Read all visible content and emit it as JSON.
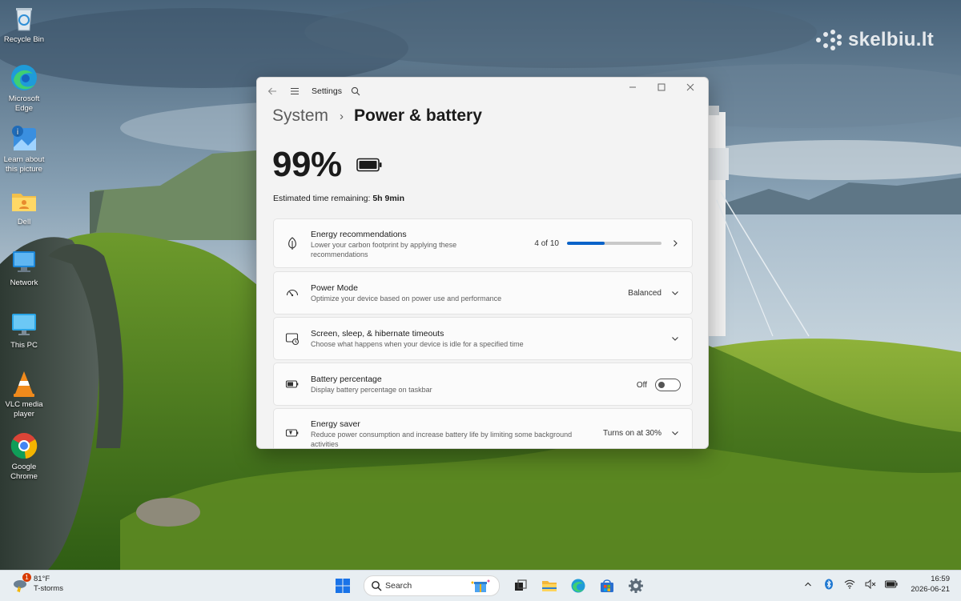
{
  "watermark": "skelbiu.lt",
  "desktop_icons": [
    {
      "label": "Recycle Bin",
      "icon": "recycle-bin-icon"
    },
    {
      "label": "Microsoft Edge",
      "icon": "edge-icon"
    },
    {
      "label": "Learn about this picture",
      "icon": "learn-picture-icon"
    },
    {
      "label": "Dell",
      "icon": "folder-icon"
    },
    {
      "label": "Network",
      "icon": "network-icon"
    },
    {
      "label": "This PC",
      "icon": "monitor-icon"
    },
    {
      "label": "VLC media player",
      "icon": "vlc-icon"
    },
    {
      "label": "Google Chrome",
      "icon": "chrome-icon"
    }
  ],
  "window": {
    "app_title": "Settings",
    "breadcrumb_root": "System",
    "breadcrumb_current": "Power & battery",
    "battery_percent": "99%",
    "time_remaining_label": "Estimated time remaining:",
    "time_remaining_value": "5h 9min",
    "cards": {
      "energy_recommendations": {
        "title": "Energy recommendations",
        "desc": "Lower your carbon footprint by applying these recommendations",
        "progress_text": "4 of 10",
        "progress_fraction": 0.4
      },
      "power_mode": {
        "title": "Power Mode",
        "desc": "Optimize your device based on power use and performance",
        "value": "Balanced"
      },
      "timeouts": {
        "title": "Screen, sleep, & hibernate timeouts",
        "desc": "Choose what happens when your device is idle for a specified time"
      },
      "battery_percentage": {
        "title": "Battery percentage",
        "desc": "Display battery percentage on taskbar",
        "toggle_state": "Off"
      },
      "energy_saver": {
        "title": "Energy saver",
        "desc": "Reduce power consumption and increase battery life by limiting some background activities",
        "value": "Turns on at 30%"
      }
    }
  },
  "taskbar": {
    "weather_badge": "1",
    "weather_temp": "81°F",
    "weather_desc": "T-storms",
    "search_label": "Search",
    "time": "16:59",
    "date": "2026-06-21"
  },
  "colors": {
    "accent": "#0a63c9",
    "window_bg": "#f3f3f3",
    "card_bg": "#fbfbfb",
    "taskbar_bg": "#e8eef2"
  }
}
